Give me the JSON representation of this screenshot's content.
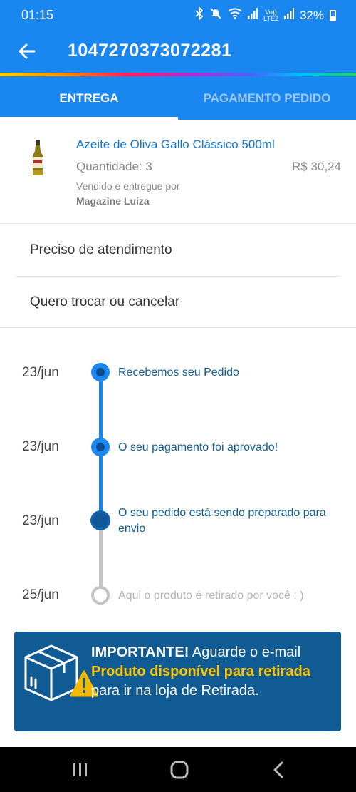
{
  "status_bar": {
    "time": "01:15",
    "battery_text": "32%",
    "net_top": "Vo))",
    "net_bottom": "LTE2",
    "icons": [
      "bluetooth-icon",
      "mute-icon",
      "wifi-icon",
      "signal-icon",
      "battery-icon"
    ]
  },
  "header": {
    "order_number": "1047270373072281",
    "back_icon": "arrow-left-icon"
  },
  "tabs": [
    {
      "label": "ENTREGA",
      "active": true
    },
    {
      "label": "PAGAMENTO PEDIDO",
      "active": false
    }
  ],
  "product": {
    "name": "Azeite de Oliva Gallo Clássico 500ml",
    "quantity": "Quantidade: 3",
    "price": "R$ 30,24",
    "sold_by_label": "Vendido e entregue por",
    "seller": "Magazine Luiza"
  },
  "options": [
    {
      "label": "Preciso de atendimento"
    },
    {
      "label": "Quero trocar ou cancelar"
    }
  ],
  "timeline": [
    {
      "date": "23/jun",
      "text": "Recebemos seu Pedido",
      "status": "done"
    },
    {
      "date": "23/jun",
      "text": "O seu pagamento foi aprovado!",
      "status": "done"
    },
    {
      "date": "23/jun",
      "text": "O seu pedido está sendo preparado para envio",
      "status": "current"
    },
    {
      "date": "25/jun",
      "text": "Aqui o produto é retirado por você : )",
      "status": "pending"
    }
  ],
  "banner": {
    "strong": "IMPORTANTE!",
    "part1": " Aguarde o e-mail ",
    "highlight": "Produto disponível para retirada",
    "part2": " para ir na loja de Retirada.",
    "icon": "package-warning-icon"
  },
  "colors": {
    "primary": "#1a86f0",
    "timeline_done": "#1a86f0",
    "timeline_pending": "#c4c4c4",
    "banner_bg": "#105b93",
    "highlight": "#ffc400"
  },
  "nav": {
    "icons": [
      "recent-apps-icon",
      "home-icon",
      "back-icon"
    ]
  }
}
